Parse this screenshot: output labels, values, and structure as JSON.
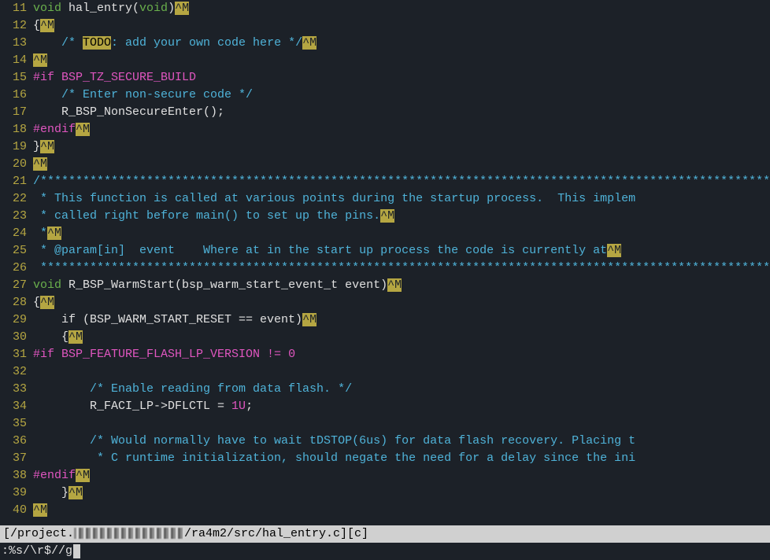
{
  "gutter": [
    "11",
    "12",
    "13",
    "14",
    "15",
    "16",
    "17",
    "18",
    "19",
    "20",
    "21",
    "22",
    "23",
    "24",
    "25",
    "26",
    "27",
    "28",
    "29",
    "30",
    "31",
    "32",
    "33",
    "34",
    "35",
    "36",
    "37",
    "38",
    "39",
    "40"
  ],
  "l11": {
    "t1": "void",
    "t2": " hal_entry(",
    "t3": "void",
    "t4": ")",
    "cr": "^M"
  },
  "l12": {
    "t1": "{",
    "cr": "^M"
  },
  "l13": {
    "c1": "    /* ",
    "todo": "TODO",
    "c2": ": add your own code here */",
    "cr": "^M"
  },
  "l14": {
    "cr": "^M"
  },
  "l15": {
    "pp": "#if",
    "rest": " BSP_TZ_SECURE_BUILD"
  },
  "l16": {
    "c1": "    /* Enter non-secure code */"
  },
  "l17": {
    "t1": "    R_BSP_NonSecureEnter();"
  },
  "l18": {
    "pp": "#endif",
    "cr": "^M"
  },
  "l19": {
    "t1": "}",
    "cr": "^M"
  },
  "l20": {
    "cr": "^M"
  },
  "l21": {
    "c": "/*****************************************************************************************************************"
  },
  "l22": {
    "c": " * This function is called at various points during the startup process.  This implem"
  },
  "l23": {
    "c": " * called right before main() to set up the pins.",
    "cr": "^M"
  },
  "l24": {
    "c": " *",
    "cr": "^M"
  },
  "l25": {
    "c": " * @param[in]  event    Where at in the start up process the code is currently at",
    "cr": "^M"
  },
  "l26": {
    "c": " ****************************************************************************************************************"
  },
  "l27": {
    "t1": "void",
    "t2": " R_BSP_WarmStart(bsp_warm_start_event_t event)",
    "cr": "^M"
  },
  "l28": {
    "t1": "{",
    "cr": "^M"
  },
  "l29": {
    "t1": "    if",
    "t2": " (BSP_WARM_START_RESET == event)",
    "cr": "^M"
  },
  "l30": {
    "t1": "    {",
    "cr": "^M"
  },
  "l31": {
    "pp": "#if",
    "rest": " BSP_FEATURE_FLASH_LP_VERSION != 0"
  },
  "l32": {
    "t1": ""
  },
  "l33": {
    "c": "        /* Enable reading from data flash. */"
  },
  "l34": {
    "t1": "        R_FACI_LP->DFLCTL = ",
    "num": "1U",
    "t2": ";"
  },
  "l35": {
    "t1": ""
  },
  "l36": {
    "c": "        /* Would normally have to wait tDSTOP(6us) for data flash recovery. Placing t"
  },
  "l37": {
    "c": "         * C runtime initialization, should negate the need for a delay since the ini"
  },
  "l38": {
    "pp": "#endif",
    "cr": "^M"
  },
  "l39": {
    "t1": "    }",
    "cr": "^M"
  },
  "l40": {
    "cr": "^M"
  },
  "status": {
    "pre": "[/project.",
    "post": "/ra4m2/src/hal_entry.c][c]"
  },
  "cmd": ":%s/\\r$//g",
  "chart_data": null
}
